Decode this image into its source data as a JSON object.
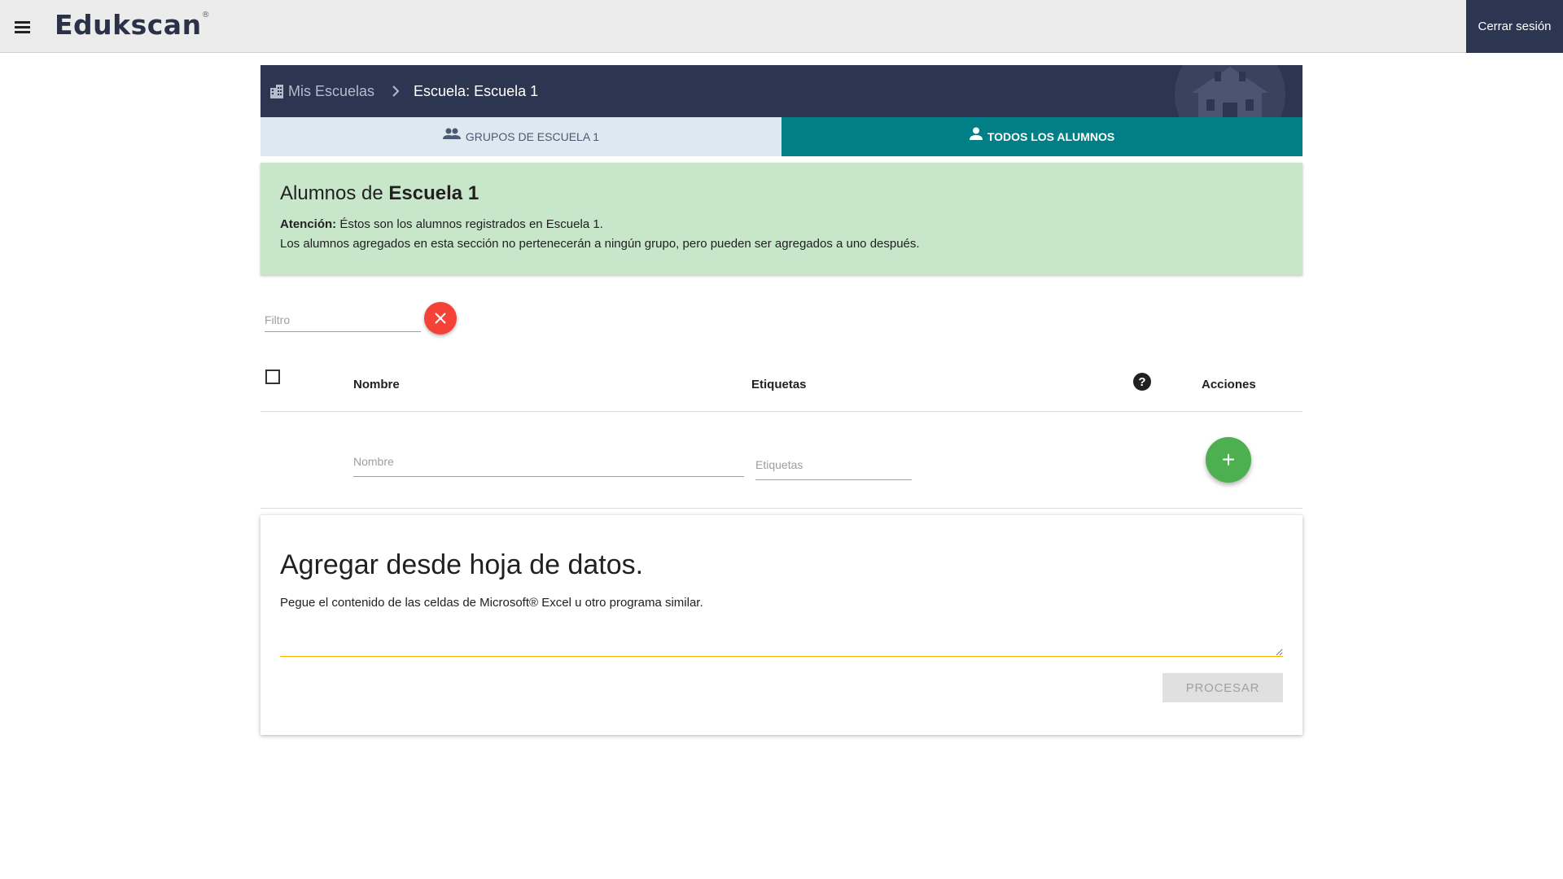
{
  "app": {
    "logo_text": "Edukscan",
    "logo_mark": "®",
    "logout_label": "Cerrar sesión"
  },
  "breadcrumb": {
    "parent_label": "Mis Escuelas",
    "current_label": "Escuela: Escuela 1"
  },
  "tabs": [
    {
      "label": "GRUPOS DE ESCUELA 1",
      "icon": "group-icon",
      "active": false
    },
    {
      "label": "TODOS LOS ALUMNOS",
      "icon": "person-icon",
      "active": true
    }
  ],
  "info": {
    "title_prefix": "Alumnos de",
    "title_school": "Escuela 1",
    "attention_label": "Atención:",
    "attention_text": "Éstos son los alumnos registrados en Escuela 1.",
    "note_text": "Los alumnos agregados en esta sección no pertenecerán a ningún grupo, pero pueden ser agregados a uno después."
  },
  "filter": {
    "placeholder": "Filtro",
    "value": ""
  },
  "table": {
    "headers": {
      "name": "Nombre",
      "tags": "Etiquetas",
      "help": "?",
      "actions": "Acciones"
    },
    "new_row": {
      "name_placeholder": "Nombre",
      "tags_placeholder": "Etiquetas",
      "add_label": "+"
    }
  },
  "paste": {
    "title": "Agregar desde hoja de datos.",
    "description": "Pegue el contenido de las celdas de Microsoft® Excel u otro programa similar.",
    "textarea_value": "",
    "process_label": "PROCESAR"
  },
  "colors": {
    "navy": "#2d3650",
    "teal": "#007f86",
    "light_tab": "#dde8f0",
    "info_green": "#c8e6c9",
    "clear_red": "#f44336",
    "add_green": "#4caf50"
  }
}
